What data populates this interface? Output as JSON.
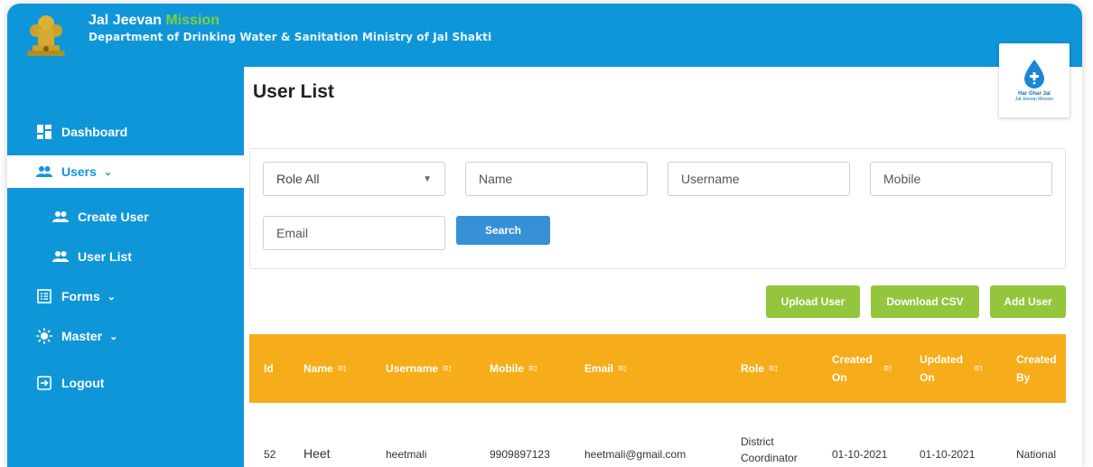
{
  "header": {
    "brand_part1": "Jal Jeevan",
    "brand_part2": "Mission",
    "department": "Department of Drinking Water & Sanitation Ministry of Jal Shakti"
  },
  "logo": {
    "line1": "Har Ghar Jal",
    "line2": "Jal Jeevan Mission"
  },
  "sidebar": {
    "items": [
      {
        "label": "Dashboard",
        "icon": "dashboard-icon"
      },
      {
        "label": "Users",
        "icon": "users-icon",
        "active": true
      },
      {
        "label": "Create User",
        "icon": "users-icon"
      },
      {
        "label": "User List",
        "icon": "users-icon"
      },
      {
        "label": "Forms",
        "icon": "form-icon"
      },
      {
        "label": "Master",
        "icon": "sun-icon"
      },
      {
        "label": "Logout",
        "icon": "logout-icon"
      }
    ]
  },
  "main": {
    "title": "User List"
  },
  "filters": {
    "role_value": "Role All",
    "name_placeholder": "Name",
    "username_placeholder": "Username",
    "mobile_placeholder": "Mobile",
    "email_placeholder": "Email",
    "search_label": "Search"
  },
  "actions": {
    "upload": "Upload User",
    "download": "Download CSV",
    "add": "Add User"
  },
  "table": {
    "headers": {
      "id": "Id",
      "name": "Name",
      "username": "Username",
      "mobile": "Mobile",
      "email": "Email",
      "role": "Role",
      "created_on_1": "Created",
      "created_on_2": "On",
      "updated_on_1": "Updated",
      "updated_on_2": "On",
      "created_by_1": "Created",
      "created_by_2": "By"
    },
    "rows": [
      {
        "id": "52",
        "name": "Heet",
        "username": "heetmali",
        "mobile": "9909897123",
        "email": "heetmali@gmail.com",
        "role_1": "District",
        "role_2": "Coordinator",
        "created_on": "01-10-2021",
        "updated_on": "01-10-2021",
        "created_by": "National"
      }
    ]
  },
  "colors": {
    "primary_blue": "#0f96d9",
    "table_header": "#f7ad19",
    "action_green": "#93c63c",
    "search_blue": "#3590d6"
  }
}
